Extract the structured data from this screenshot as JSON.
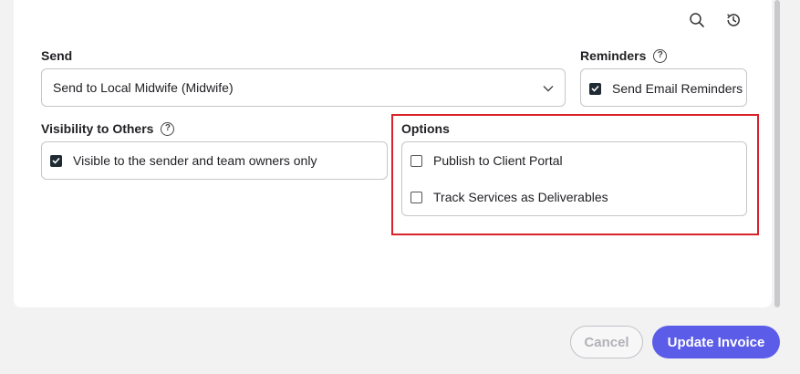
{
  "send": {
    "label": "Send",
    "selected": "Send to Local Midwife (Midwife)"
  },
  "reminders": {
    "label": "Reminders",
    "option": "Send Email Reminders",
    "checked": true
  },
  "visibility": {
    "label": "Visibility to Others",
    "option": "Visible to the sender and team owners only",
    "checked": true
  },
  "options": {
    "label": "Options",
    "items": [
      {
        "label": "Publish to Client Portal",
        "checked": false
      },
      {
        "label": "Track Services as Deliverables",
        "checked": false
      }
    ]
  },
  "toolbar": {
    "icons": [
      "search-icon",
      "history-icon"
    ]
  },
  "footer": {
    "cancel_label": "Cancel",
    "update_label": "Update Invoice"
  },
  "colors": {
    "accent": "#5b5ce8",
    "highlight": "#d9222a",
    "checkbox_checked": "#1f2a33"
  }
}
